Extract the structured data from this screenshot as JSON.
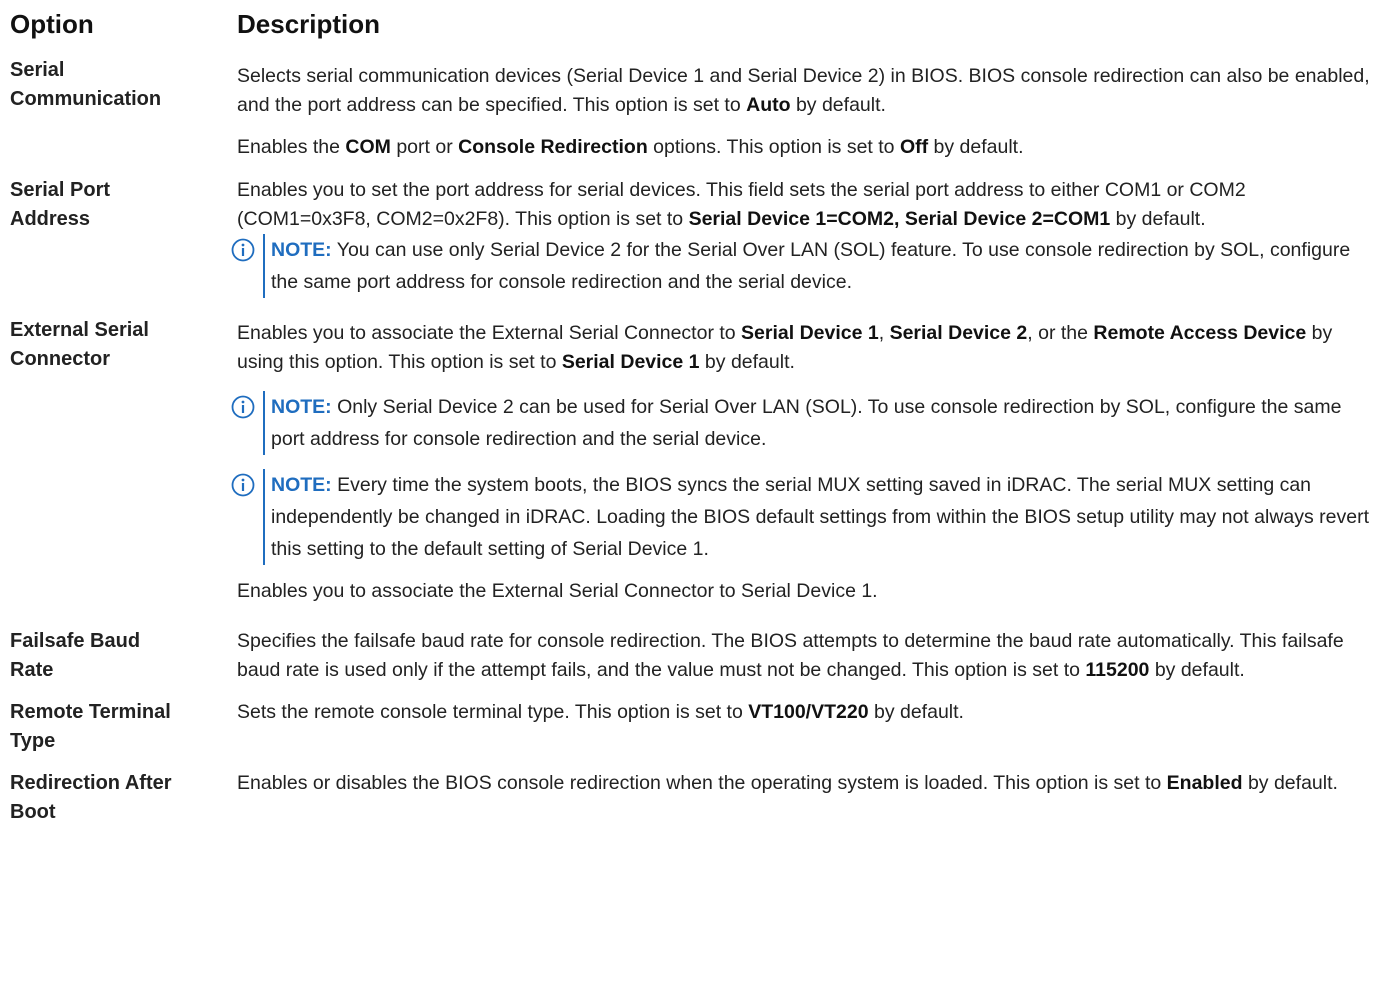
{
  "header": {
    "option": "Option",
    "description": "Description"
  },
  "rows": [
    {
      "option": [
        "Serial",
        "Communication"
      ],
      "p1": {
        "a": "Selects serial communication devices (Serial Device 1 and Serial Device 2) in BIOS. BIOS console redirection can also be enabled, and the port address can be specified. This option is set to ",
        "b": "Auto",
        "c": " by default."
      },
      "p2": {
        "a": "Enables the ",
        "b1": "COM",
        "m": " port or ",
        "b2": "Console Redirection",
        "m2": " options. This option is set to ",
        "b3": "Off",
        "c": " by default."
      }
    },
    {
      "option": [
        "Serial Port",
        "Address"
      ],
      "p1": {
        "a": "Enables you to set the port address for serial devices. This field sets the serial port address to either COM1 or COM2 (COM1=0x3F8, COM2=0x2F8). This option is set to ",
        "b": "Serial Device 1=COM2, Serial Device 2=COM1",
        "c": " by default."
      },
      "note": {
        "label": "NOTE:",
        "text": " You can use only Serial Device 2 for the Serial Over LAN (SOL) feature. To use console redirection by SOL, configure the same port address for console redirection and the serial device."
      }
    },
    {
      "option": [
        "External Serial",
        "Connector"
      ],
      "p1": {
        "a": "Enables you to associate the External Serial Connector to ",
        "b1": "Serial Device 1",
        "m1": ", ",
        "b2": "Serial Device 2",
        "m2": ", or the ",
        "b3": "Remote Access Device",
        "m3": " by using this option. This option is set to ",
        "b4": "Serial Device 1",
        "c": " by default."
      },
      "note1": {
        "label": "NOTE:",
        "text": " Only Serial Device 2 can be used for Serial Over LAN (SOL). To use console redirection by SOL, configure the same port address for console redirection and the serial device."
      },
      "note2": {
        "label": "NOTE:",
        "text": " Every time the system boots, the BIOS syncs the serial MUX setting saved in iDRAC. The serial MUX setting can independently be changed in iDRAC. Loading the BIOS default settings from within the BIOS setup utility may not always revert this setting to the default setting of Serial Device 1."
      },
      "p2": "Enables you to associate the External Serial Connector to Serial Device 1."
    },
    {
      "option": [
        "Failsafe Baud",
        "Rate"
      ],
      "p1": {
        "a": "Specifies the failsafe baud rate for console redirection. The BIOS attempts to determine the baud rate automatically. This failsafe baud rate is used only if the attempt fails, and the value must not be changed. This option is set to ",
        "b": "115200",
        "c": " by default."
      }
    },
    {
      "option": [
        "Remote Terminal",
        "Type"
      ],
      "p1": {
        "a": "Sets the remote console terminal type. This option is set to ",
        "b": "VT100/VT220",
        "c": " by default."
      }
    },
    {
      "option": [
        "Redirection After",
        "Boot"
      ],
      "p1": {
        "a": "Enables or disables the BIOS console redirection when the operating system is loaded. This option is set to ",
        "b": "Enabled",
        "c": " by default."
      }
    }
  ],
  "colors": {
    "note_accent": "#1f6dbf",
    "text": "#222222"
  },
  "icons": {
    "note": "info-circle-icon"
  }
}
